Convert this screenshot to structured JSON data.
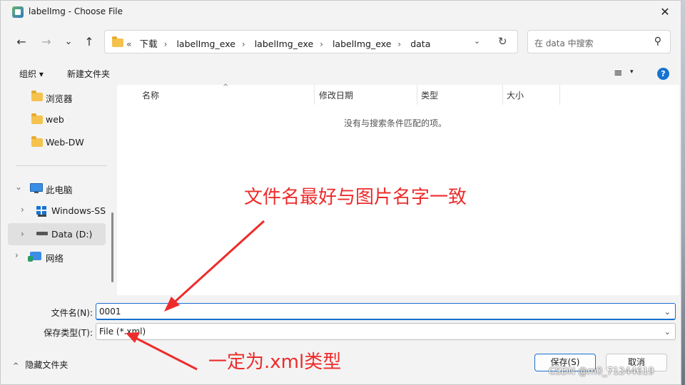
{
  "window": {
    "title": "labelImg - Choose File",
    "close_label": "✕"
  },
  "nav": {
    "back_icon": "←",
    "forward_icon": "→",
    "recent_icon": "⌄",
    "up_icon": "↑"
  },
  "address": {
    "overflow": "«",
    "crumbs": [
      "下载",
      "labelImg_exe",
      "labelImg_exe",
      "labelImg_exe",
      "data"
    ],
    "separator": "›",
    "dropdown_icon": "⌄",
    "refresh_icon": "↻"
  },
  "search": {
    "placeholder": "在 data 中搜索",
    "icon": "⚲"
  },
  "commandbar": {
    "organize": "组织 ▾",
    "new_folder": "新建文件夹",
    "view_icon": "≡",
    "view_dropdown": "▾",
    "help": "?"
  },
  "sidebar": {
    "items": [
      {
        "label": "浏览器",
        "icon": "folder-icon"
      },
      {
        "label": "web",
        "icon": "folder-icon"
      },
      {
        "label": "Web-DW",
        "icon": "folder-icon"
      },
      {
        "label": "此电脑",
        "icon": "pc-icon",
        "expander": "⌄"
      },
      {
        "label": "Windows-SSD",
        "icon": "windows-drive-icon",
        "expander": "›"
      },
      {
        "label": "Data (D:)",
        "icon": "drive-icon",
        "expander": "›",
        "selected": true
      },
      {
        "label": "网络",
        "icon": "network-icon",
        "expander": "›"
      }
    ]
  },
  "content": {
    "columns": [
      "名称",
      "修改日期",
      "类型",
      "大小"
    ],
    "sort_indicator": "^",
    "empty_message": "没有与搜索条件匹配的项。"
  },
  "bottom": {
    "filename_label": "文件名(N):",
    "filename_value": "0001",
    "filetype_label": "保存类型(T):",
    "filetype_value": "File (*.xml)",
    "dropdown_icon": "⌄",
    "hide_folders": "隐藏文件夹",
    "hide_folders_icon": "^",
    "save_button": "保存(S)",
    "cancel_button": "取消"
  },
  "annotations": {
    "filename_note": "文件名最好与图片名字一致",
    "type_note": "一定为.xml类型",
    "color": "#ee2b2b"
  },
  "watermark": "CSDN @m0_71244619"
}
